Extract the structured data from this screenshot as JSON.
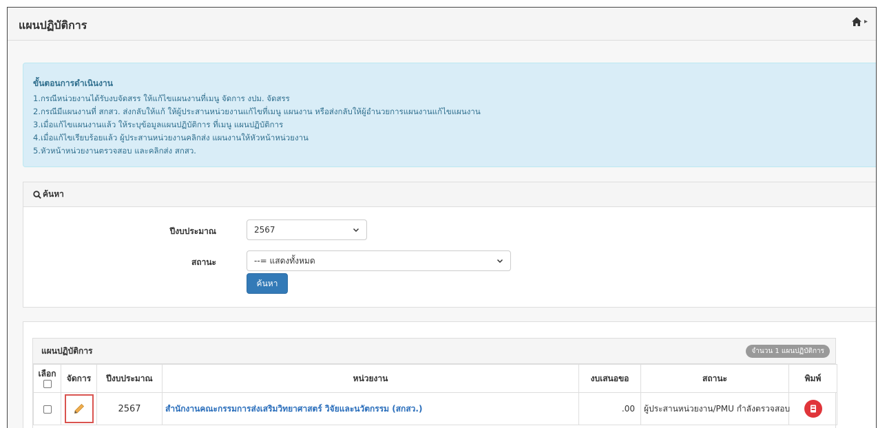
{
  "header": {
    "title": "แผนปฏิบัติการ",
    "home_icon": "home-icon"
  },
  "info": {
    "title": "ขั้นตอนการดำเนินงาน",
    "steps": [
      "1.กรณีหน่วยงานได้รับงบจัดสรร ให้แก้ไขแผนงานที่เมนู จัดการ งปม. จัดสรร",
      "2.กรณีมีแผนงานที่ สกสว. ส่งกลับให้แก้ ให้ผู้ประสานหน่วยงานแก้ไขที่เมนู แผนงาน หรือส่งกลับให้ผู้อำนวยการแผนงานแก้ไขแผนงาน",
      "3.เมื่อแก้ไขแผนงานแล้ว ให้ระบุข้อมูลแผนปฏิบัติการ ที่เมนู แผนปฏิบัติการ",
      "4.เมื่อแก้ไขเรียบร้อยแล้ว ผู้ประสานหน่วยงานคลิกส่ง แผนงานให้หัวหน้าหน่วยงาน",
      "5.หัวหน้าหน่วยงานตรวจสอบ และคลิกส่ง สกสว."
    ]
  },
  "search": {
    "panel_title": "ค้นหา",
    "year_label": "ปีงบประมาณ",
    "year_value": "2567",
    "status_label": "สถานะ",
    "status_value": "--= แสดงทั้งหมด",
    "button_label": "ค้นหา"
  },
  "plan_table": {
    "title": "แผนปฏิบัติการ",
    "count_badge": "จำนวน 1 แผนปฏิบัติการ",
    "columns": {
      "select": "เลือก",
      "manage": "จัดการ",
      "year": "ปีงบประมาณ",
      "unit": "หน่วยงาน",
      "budget": "งบเสนอขอ",
      "status": "สถานะ",
      "print": "พิมพ์"
    },
    "rows": [
      {
        "year": "2567",
        "unit": "สำนักงานคณะกรรมการส่งเสริมวิทยาศาสตร์ วิจัยและนวัตกรรม (สกสว.)",
        "budget": ".00",
        "status": "ผู้ประสานหน่วยงาน/PMU กำลังตรวจสอบ"
      }
    ]
  },
  "colors": {
    "info_bg": "#d9edf7",
    "info_text": "#31708f",
    "primary": "#337ab7",
    "link": "#2a6ebb",
    "print_red": "#e0353a",
    "highlight_border": "#d9534f"
  }
}
